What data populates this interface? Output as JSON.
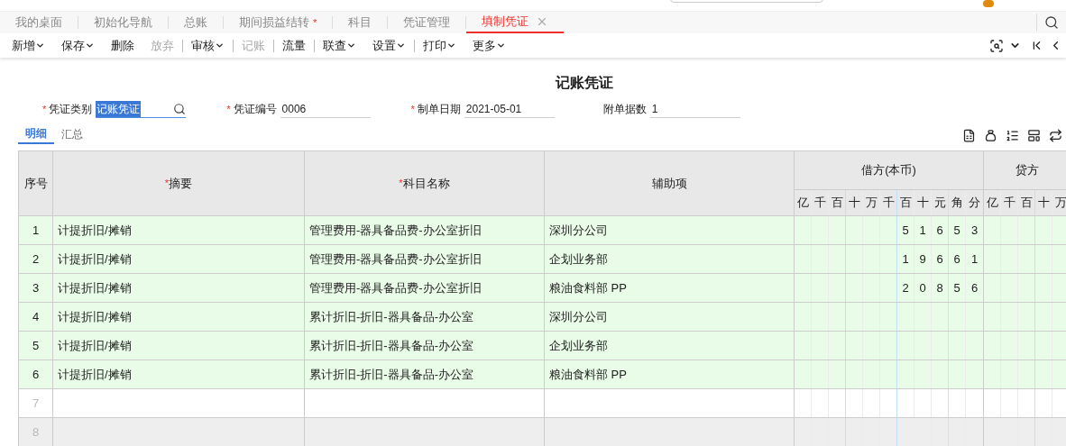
{
  "tabs": [
    {
      "label": "我的桌面",
      "selected": false,
      "closable": false
    },
    {
      "label": "初始化导航",
      "selected": false,
      "closable": false
    },
    {
      "label": "总账",
      "selected": false,
      "closable": false
    },
    {
      "label": "期间损益结转",
      "marker": "*",
      "selected": false,
      "closable": false
    },
    {
      "label": "科目",
      "selected": false,
      "closable": false
    },
    {
      "label": "凭证管理",
      "selected": false,
      "closable": false
    },
    {
      "label": "填制凭证",
      "selected": true,
      "closable": true
    }
  ],
  "toolbar": [
    {
      "label": "新增",
      "dropdown": true,
      "disabled": false,
      "divider_after": false
    },
    {
      "label": "保存",
      "dropdown": true,
      "disabled": false,
      "divider_after": false
    },
    {
      "label": "删除",
      "dropdown": false,
      "disabled": false,
      "divider_after": false
    },
    {
      "label": "放弃",
      "dropdown": false,
      "disabled": true,
      "divider_after": true
    },
    {
      "label": "审核",
      "dropdown": true,
      "disabled": false,
      "divider_after": true
    },
    {
      "label": "记账",
      "dropdown": false,
      "disabled": true,
      "divider_after": true
    },
    {
      "label": "流量",
      "dropdown": false,
      "disabled": false,
      "divider_after": true
    },
    {
      "label": "联查",
      "dropdown": true,
      "disabled": false,
      "divider_after": false
    },
    {
      "label": "设置",
      "dropdown": true,
      "disabled": false,
      "divider_after": true
    },
    {
      "label": "打印",
      "dropdown": true,
      "disabled": false,
      "divider_after": false
    },
    {
      "label": "更多",
      "dropdown": true,
      "disabled": false,
      "divider_after": false
    }
  ],
  "title": "记账凭证",
  "form": [
    {
      "marker": "*",
      "label": "凭证类别",
      "value": "记账凭证",
      "kind": "lookup"
    },
    {
      "marker": "*",
      "label": "凭证编号",
      "value": "0006",
      "kind": "text"
    },
    {
      "marker": "*",
      "label": "制单日期",
      "value": "2021-05-01",
      "kind": "text"
    },
    {
      "label": "附单据数",
      "value": "1",
      "kind": "text"
    }
  ],
  "subtabs": [
    {
      "label": "明细",
      "selected": true
    },
    {
      "label": "汇总",
      "selected": false
    }
  ],
  "table": {
    "columns": [
      {
        "label": "序号"
      },
      {
        "marker": "*",
        "label": "摘要"
      },
      {
        "marker": "*",
        "label": "科目名称"
      },
      {
        "label": "辅助项"
      }
    ],
    "debit_header": "借方(本币)",
    "credit_header": "贷方",
    "debit_units": [
      "亿",
      "千",
      "百",
      "十",
      "万",
      "千",
      "百",
      "十",
      "元",
      "角",
      "分"
    ],
    "credit_units": [
      "亿",
      "千",
      "百",
      "十",
      "万"
    ],
    "rows": [
      {
        "no": "1",
        "summary": "计提折旧/摊销",
        "account": "管理费用-器具备品费-办公室折旧",
        "aux": "深圳分公司",
        "debit": [
          "5",
          "1",
          "6",
          "5",
          "3"
        ],
        "filled": true,
        "hovered": false
      },
      {
        "no": "2",
        "summary": "计提折旧/摊销",
        "account": "管理费用-器具备品费-办公室折旧",
        "aux": "企划业务部",
        "debit": [
          "1",
          "9",
          "6",
          "6",
          "1"
        ],
        "filled": true,
        "hovered": false
      },
      {
        "no": "3",
        "summary": "计提折旧/摊销",
        "account": "管理费用-器具备品费-办公室折旧",
        "aux": "粮油食料部 PP",
        "debit": [
          "2",
          "0",
          "8",
          "5",
          "6"
        ],
        "filled": true,
        "hovered": false
      },
      {
        "no": "4",
        "summary": "计提折旧/摊销",
        "account": "累计折旧-折旧-器具备品-办公室",
        "aux": "深圳分公司",
        "filled": true,
        "hovered": false
      },
      {
        "no": "5",
        "summary": "计提折旧/摊销",
        "account": "累计折旧-折旧-器具备品-办公室",
        "aux": "企划业务部",
        "filled": true,
        "hovered": false
      },
      {
        "no": "6",
        "summary": "计提折旧/摊销",
        "account": "累计折旧-折旧-器具备品-办公室",
        "aux": "粮油食料部 PP",
        "filled": true,
        "hovered": false
      },
      {
        "no": "7",
        "filled": false,
        "hovered": false
      },
      {
        "no": "8",
        "filled": false,
        "hovered": true
      }
    ]
  }
}
